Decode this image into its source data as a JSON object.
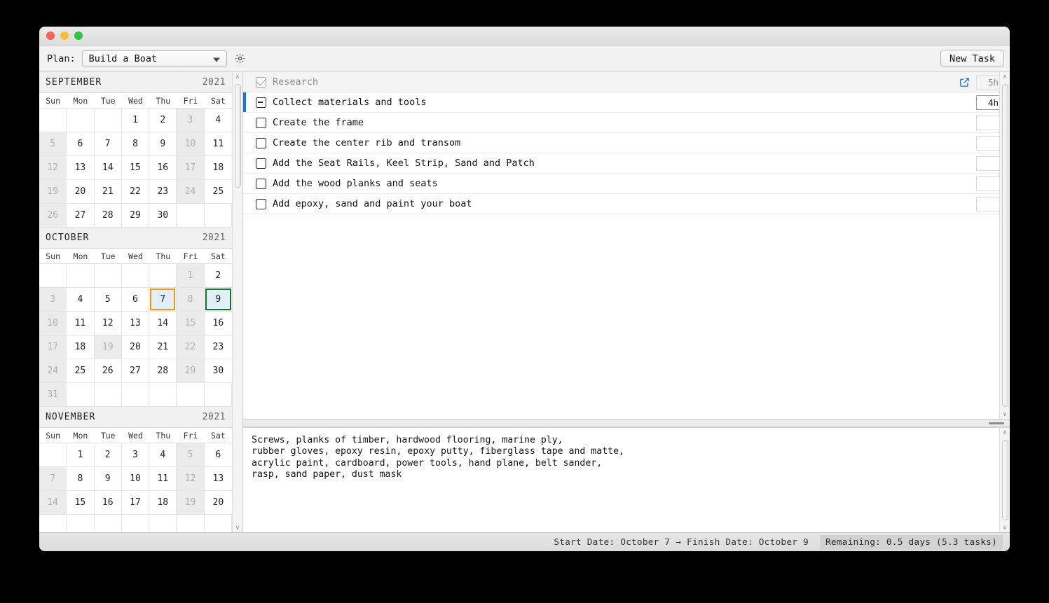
{
  "window": {
    "traffic_lights": [
      "close",
      "minimize",
      "zoom"
    ]
  },
  "toolbar": {
    "plan_label": "Plan:",
    "plan_value": "Build a Boat",
    "gear_icon": "gear-icon",
    "new_task_label": "New Task"
  },
  "calendar": {
    "scroll_up_glyph": "∧",
    "scroll_down_glyph": "∨",
    "day_names": [
      "Sun",
      "Mon",
      "Tue",
      "Wed",
      "Thu",
      "Fri",
      "Sat"
    ],
    "months": [
      {
        "name": "SEPTEMBER",
        "year": "2021",
        "days": [
          {
            "n": "",
            "state": "blank"
          },
          {
            "n": "",
            "state": "blank"
          },
          {
            "n": "",
            "state": "blank"
          },
          {
            "n": "1",
            "state": "work"
          },
          {
            "n": "2",
            "state": "work"
          },
          {
            "n": "3",
            "state": "off"
          },
          {
            "n": "4",
            "state": "work"
          },
          {
            "n": "5",
            "state": "off"
          },
          {
            "n": "6",
            "state": "work"
          },
          {
            "n": "7",
            "state": "work"
          },
          {
            "n": "8",
            "state": "work"
          },
          {
            "n": "9",
            "state": "work"
          },
          {
            "n": "10",
            "state": "off"
          },
          {
            "n": "11",
            "state": "work"
          },
          {
            "n": "12",
            "state": "off"
          },
          {
            "n": "13",
            "state": "work"
          },
          {
            "n": "14",
            "state": "work"
          },
          {
            "n": "15",
            "state": "work"
          },
          {
            "n": "16",
            "state": "work"
          },
          {
            "n": "17",
            "state": "off"
          },
          {
            "n": "18",
            "state": "work"
          },
          {
            "n": "19",
            "state": "off"
          },
          {
            "n": "20",
            "state": "work"
          },
          {
            "n": "21",
            "state": "work"
          },
          {
            "n": "22",
            "state": "work"
          },
          {
            "n": "23",
            "state": "work"
          },
          {
            "n": "24",
            "state": "off"
          },
          {
            "n": "25",
            "state": "work"
          },
          {
            "n": "26",
            "state": "off"
          },
          {
            "n": "27",
            "state": "work"
          },
          {
            "n": "28",
            "state": "work"
          },
          {
            "n": "29",
            "state": "work"
          },
          {
            "n": "30",
            "state": "work"
          },
          {
            "n": "",
            "state": "blank"
          },
          {
            "n": "",
            "state": "blank"
          }
        ]
      },
      {
        "name": "OCTOBER",
        "year": "2021",
        "days": [
          {
            "n": "",
            "state": "blank"
          },
          {
            "n": "",
            "state": "blank"
          },
          {
            "n": "",
            "state": "blank"
          },
          {
            "n": "",
            "state": "blank"
          },
          {
            "n": "",
            "state": "blank"
          },
          {
            "n": "1",
            "state": "off"
          },
          {
            "n": "2",
            "state": "work"
          },
          {
            "n": "3",
            "state": "off"
          },
          {
            "n": "4",
            "state": "work"
          },
          {
            "n": "5",
            "state": "work"
          },
          {
            "n": "6",
            "state": "work"
          },
          {
            "n": "7",
            "state": "start"
          },
          {
            "n": "8",
            "state": "off"
          },
          {
            "n": "9",
            "state": "finish"
          },
          {
            "n": "10",
            "state": "off"
          },
          {
            "n": "11",
            "state": "work"
          },
          {
            "n": "12",
            "state": "work"
          },
          {
            "n": "13",
            "state": "work"
          },
          {
            "n": "14",
            "state": "work"
          },
          {
            "n": "15",
            "state": "off"
          },
          {
            "n": "16",
            "state": "work"
          },
          {
            "n": "17",
            "state": "off"
          },
          {
            "n": "18",
            "state": "work"
          },
          {
            "n": "19",
            "state": "off"
          },
          {
            "n": "20",
            "state": "work"
          },
          {
            "n": "21",
            "state": "work"
          },
          {
            "n": "22",
            "state": "off"
          },
          {
            "n": "23",
            "state": "work"
          },
          {
            "n": "24",
            "state": "off"
          },
          {
            "n": "25",
            "state": "work"
          },
          {
            "n": "26",
            "state": "work"
          },
          {
            "n": "27",
            "state": "work"
          },
          {
            "n": "28",
            "state": "work"
          },
          {
            "n": "29",
            "state": "off"
          },
          {
            "n": "30",
            "state": "work"
          },
          {
            "n": "31",
            "state": "off"
          },
          {
            "n": "",
            "state": "blank"
          },
          {
            "n": "",
            "state": "blank"
          },
          {
            "n": "",
            "state": "blank"
          },
          {
            "n": "",
            "state": "blank"
          },
          {
            "n": "",
            "state": "blank"
          },
          {
            "n": "",
            "state": "blank"
          }
        ]
      },
      {
        "name": "NOVEMBER",
        "year": "2021",
        "days": [
          {
            "n": "",
            "state": "blank"
          },
          {
            "n": "1",
            "state": "work"
          },
          {
            "n": "2",
            "state": "work"
          },
          {
            "n": "3",
            "state": "work"
          },
          {
            "n": "4",
            "state": "work"
          },
          {
            "n": "5",
            "state": "off"
          },
          {
            "n": "6",
            "state": "work"
          },
          {
            "n": "7",
            "state": "off"
          },
          {
            "n": "8",
            "state": "work"
          },
          {
            "n": "9",
            "state": "work"
          },
          {
            "n": "10",
            "state": "work"
          },
          {
            "n": "11",
            "state": "work"
          },
          {
            "n": "12",
            "state": "off"
          },
          {
            "n": "13",
            "state": "work"
          },
          {
            "n": "14",
            "state": "off"
          },
          {
            "n": "15",
            "state": "work"
          },
          {
            "n": "16",
            "state": "work"
          },
          {
            "n": "17",
            "state": "work"
          },
          {
            "n": "18",
            "state": "work"
          },
          {
            "n": "19",
            "state": "off"
          },
          {
            "n": "20",
            "state": "work"
          },
          {
            "n": "",
            "state": "blank"
          },
          {
            "n": "",
            "state": "blank"
          },
          {
            "n": "",
            "state": "blank"
          },
          {
            "n": "",
            "state": "blank"
          },
          {
            "n": "",
            "state": "blank"
          },
          {
            "n": "",
            "state": "blank"
          },
          {
            "n": "",
            "state": "blank"
          }
        ]
      }
    ]
  },
  "tasks": [
    {
      "title": "Research",
      "check": "done",
      "duration": "5h",
      "duration_style": "ghost",
      "has_link": true,
      "active": false,
      "header": true
    },
    {
      "title": "Collect materials and tools",
      "check": "partial",
      "duration": "4h",
      "duration_style": "filled",
      "has_link": false,
      "active": true,
      "header": false
    },
    {
      "title": "Create the frame",
      "check": "empty",
      "duration": "",
      "duration_style": "empty",
      "has_link": false,
      "active": false,
      "header": false
    },
    {
      "title": "Create the center rib and transom",
      "check": "empty",
      "duration": "",
      "duration_style": "empty",
      "has_link": false,
      "active": false,
      "header": false
    },
    {
      "title": "Add the Seat Rails, Keel Strip, Sand and Patch",
      "check": "empty",
      "duration": "",
      "duration_style": "empty",
      "has_link": false,
      "active": false,
      "header": false
    },
    {
      "title": "Add the wood planks and seats",
      "check": "empty",
      "duration": "",
      "duration_style": "empty",
      "has_link": false,
      "active": false,
      "header": false
    },
    {
      "title": "Add epoxy, sand and paint your boat",
      "check": "empty",
      "duration": "",
      "duration_style": "empty",
      "has_link": false,
      "active": false,
      "header": false
    }
  ],
  "notes": {
    "text": "Screws, planks of timber, hardwood flooring, marine ply,\nrubber gloves, epoxy resin, epoxy putty, fiberglass tape and matte,\nacrylic paint, cardboard, power tools, hand plane, belt sander,\nrasp, sand paper, dust mask"
  },
  "statusbar": {
    "dates": "Start Date: October 7 → Finish Date: October 9",
    "remaining": "Remaining: 0.5 days (5.3 tasks)"
  },
  "colors": {
    "start_border": "#f0960a",
    "finish_border": "#0f7a22",
    "selected_day_bg": "#e3eefb",
    "active_row_indicator": "#1a72e8",
    "link_icon": "#1a72e8"
  }
}
